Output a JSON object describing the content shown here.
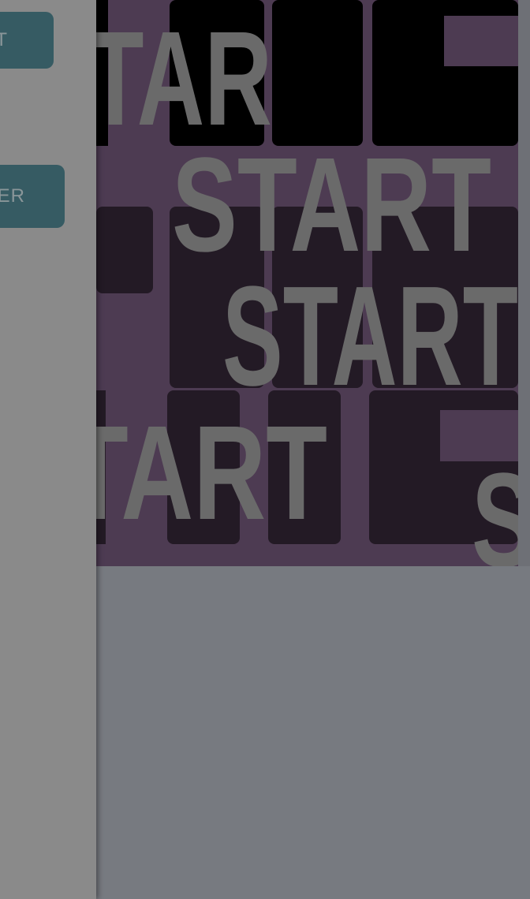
{
  "artwork": {
    "words": [
      "TAR",
      "START",
      "START",
      "TART",
      "S"
    ]
  },
  "drawer": {
    "button_1_label": "T",
    "button_2_label": "ER"
  },
  "colors": {
    "artwork_background": "#4d3b52",
    "artwork_blocks": "#231a25",
    "artwork_text": "#6a6a6a",
    "drawer_background": "#8a8a8a",
    "drawer_button": "#365b63",
    "page_background": "#777a80"
  }
}
